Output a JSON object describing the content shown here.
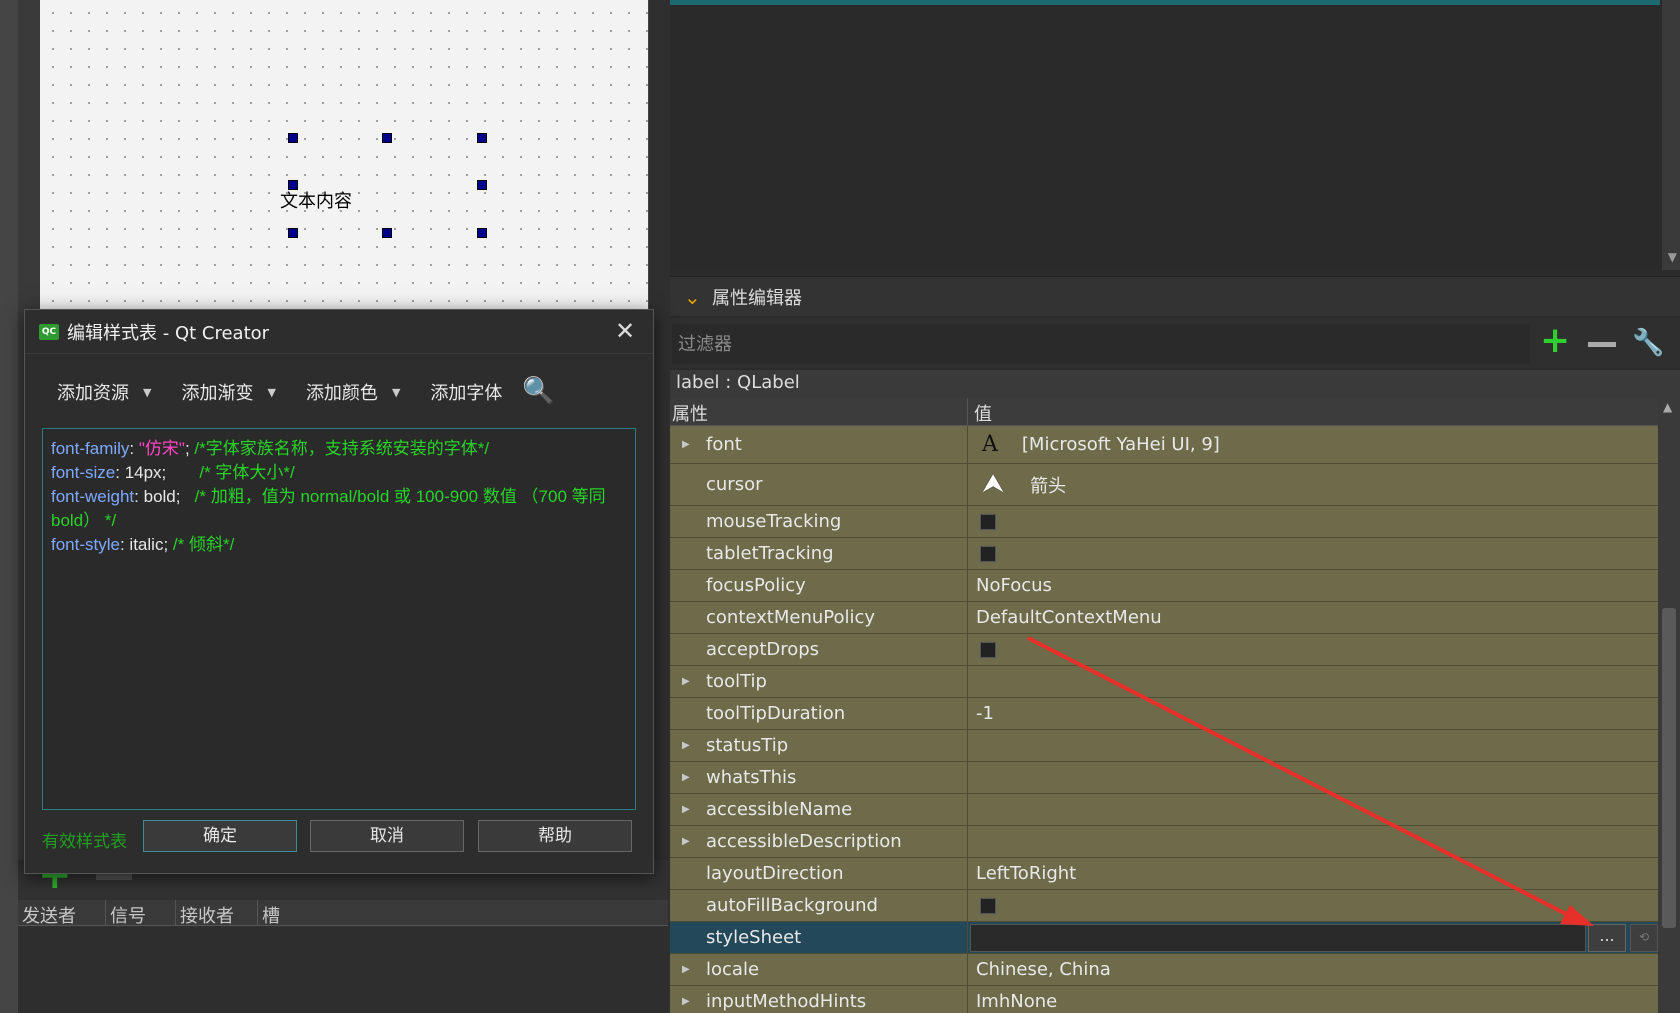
{
  "canvas": {
    "label_text": "文本内容"
  },
  "signal_slot": {
    "columns": [
      "发送者",
      "信号",
      "接收者",
      "槽"
    ]
  },
  "property_editor": {
    "title": "属性编辑器",
    "filter_placeholder": "过滤器",
    "object_class": "label : QLabel",
    "col_property": "属性",
    "col_value": "值",
    "rows": [
      {
        "name": "font",
        "value": "[Microsoft YaHei UI, 9]"
      },
      {
        "name": "cursor",
        "value": "箭头"
      },
      {
        "name": "mouseTracking",
        "value": ""
      },
      {
        "name": "tabletTracking",
        "value": ""
      },
      {
        "name": "focusPolicy",
        "value": "NoFocus"
      },
      {
        "name": "contextMenuPolicy",
        "value": "DefaultContextMenu"
      },
      {
        "name": "acceptDrops",
        "value": ""
      },
      {
        "name": "toolTip",
        "value": ""
      },
      {
        "name": "toolTipDuration",
        "value": "-1"
      },
      {
        "name": "statusTip",
        "value": ""
      },
      {
        "name": "whatsThis",
        "value": ""
      },
      {
        "name": "accessibleName",
        "value": ""
      },
      {
        "name": "accessibleDescription",
        "value": ""
      },
      {
        "name": "layoutDirection",
        "value": "LeftToRight"
      },
      {
        "name": "autoFillBackground",
        "value": ""
      },
      {
        "name": "styleSheet",
        "value": "",
        "more_label": "..."
      },
      {
        "name": "locale",
        "value": "Chinese, China"
      },
      {
        "name": "inputMethodHints",
        "value": "ImhNone"
      }
    ]
  },
  "dialog": {
    "icon_text": "QC",
    "title": "编辑样式表 - Qt Creator",
    "toolbar": {
      "add_resource": "添加资源",
      "add_gradient": "添加渐变",
      "add_color": "添加颜色",
      "add_font": "添加字体"
    },
    "code": {
      "l1_prop": "font-family",
      "l1_sep": ":  ",
      "l1_str": "\"仿宋\"",
      "l1_semi": ";",
      "l1_comment": "/*字体家族名称，支持系统安装的字体*/",
      "l2_prop": "font-size",
      "l2_val": ": 14px;",
      "l2_comment": "/* 字体大小*/",
      "l3_prop": "font-weight",
      "l3_val": ": bold;",
      "l3_comment": "/* 加粗，值为 normal/bold 或 100-900 数值 （700 等同 bold） */",
      "l4_prop": "font-style",
      "l4_val": ": italic;",
      "l4_comment": "/* 倾斜*/"
    },
    "status": "有效样式表",
    "ok": "确定",
    "cancel": "取消",
    "help": "帮助"
  },
  "colors": {
    "accent_teal": "#1e6a72",
    "property_row_bg": "#6d6b4a",
    "selected_row_bg": "#22485a",
    "code_keyword": "#7ea9ff",
    "code_string": "#ff45c5",
    "code_comment": "#27d427",
    "annotation_arrow": "#e8302a"
  }
}
